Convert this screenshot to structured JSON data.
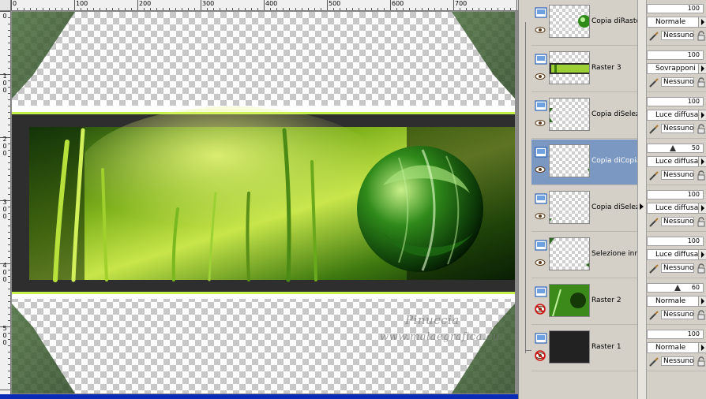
{
  "rulers": {
    "top_labels": [
      "0",
      "100",
      "200",
      "300",
      "400",
      "500",
      "600",
      "700"
    ],
    "left_labels": [
      "0",
      "1",
      "0",
      "0",
      "2",
      "0",
      "0",
      "3",
      "0",
      "0",
      "4",
      "0",
      "0",
      "5",
      "0",
      "0"
    ]
  },
  "canvas": {
    "watermark_line1": "Pinuccia",
    "watermark_line2": "www.malaegrafica.eu",
    "accent_color": "#c6f04a",
    "banner_color": "#2e2e2e"
  },
  "layers": [
    {
      "name": "Copia diRaste",
      "opacity": "100",
      "opacity_fraction": 1.0,
      "blend": "Normale",
      "mask": "Nessuno",
      "visible": true,
      "selected": false
    },
    {
      "name": "Raster 3",
      "opacity": "100",
      "opacity_fraction": 1.0,
      "blend": "Sovrapponi",
      "mask": "Nessuno",
      "visible": true,
      "selected": false
    },
    {
      "name": "Copia diSelezi",
      "opacity": "100",
      "opacity_fraction": 1.0,
      "blend": "Luce diffusa",
      "mask": "Nessuno",
      "visible": true,
      "selected": false
    },
    {
      "name": "Copia diCopia",
      "opacity": "50",
      "opacity_fraction": 0.5,
      "blend": "Luce diffusa",
      "mask": "Nessuno",
      "visible": true,
      "selected": true
    },
    {
      "name": "Copia diSelezi",
      "opacity": "100",
      "opacity_fraction": 1.0,
      "blend": "Luce diffusa",
      "mask": "Nessuno",
      "visible": true,
      "selected": false
    },
    {
      "name": "Selezione inna",
      "opacity": "100",
      "opacity_fraction": 1.0,
      "blend": "Luce diffusa",
      "mask": "Nessuno",
      "visible": true,
      "selected": false
    },
    {
      "name": "Raster 2",
      "opacity": "60",
      "opacity_fraction": 0.6,
      "blend": "Normale",
      "mask": "Nessuno",
      "visible": false,
      "selected": false
    },
    {
      "name": "Raster 1",
      "opacity": "100",
      "opacity_fraction": 1.0,
      "blend": "Normale",
      "mask": "Nessuno",
      "visible": false,
      "selected": false
    }
  ],
  "icons": {
    "layer_type": "raster-layer-icon",
    "visibility_on": "eye-icon",
    "visibility_off": "hidden-eye-icon",
    "mask": "mask-brush-icon",
    "lock": "lock-icon"
  }
}
